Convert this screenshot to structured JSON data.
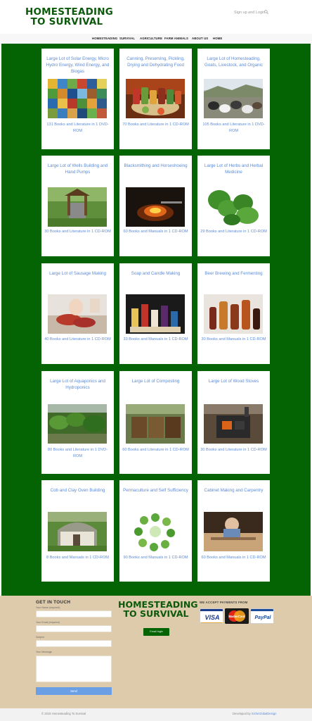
{
  "brand": {
    "logo_line1": "HOMESTEADING",
    "logo_line2": "TO SURVIVAL"
  },
  "header": {
    "signin": "Sign up and Login"
  },
  "nav": {
    "items": [
      "HOMESTEADING",
      "SURVIVAL",
      "AGRICULTURE",
      "FARM ANIMALS",
      "ABOUT US",
      "HOME"
    ]
  },
  "products": [
    {
      "title": "Large Lot of Solar Energy, Micro Hydro Energy, Wind Energy, and Biogas",
      "desc": "131 Books and Literature in 1 DVD-ROM"
    },
    {
      "title": "Canning, Preserving, Pickling, Drying and Dehydrating Food",
      "desc": "70 Books and Literature in 1 CD-ROM"
    },
    {
      "title": "Large Lot of Homesteading, Goats, Livestock, and Organic",
      "desc": "105 Books and Literature in 1 DVD-ROM"
    },
    {
      "title": "Large Lot of Wells Building and Hand Pumps",
      "desc": "30 Books and Literature in 1 CD-ROM"
    },
    {
      "title": "Blacksmithing and Horseshoeing",
      "desc": "60 Books and Manuals in 1 CD-ROM"
    },
    {
      "title": "Large Lot of Herbs and Herbal Medicine",
      "desc": "29 Books and Literature in 1 CD-ROM"
    },
    {
      "title": "Large Lot of Sausage Making",
      "desc": "40 Books and Literature in 1 CD-ROM"
    },
    {
      "title": "Soap and Candle Making",
      "desc": "33 Books and Manuals in 1 CD-ROM"
    },
    {
      "title": "Beer Brewing and Fermenting",
      "desc": "30 Books and Manuals in 1 CD-ROM"
    },
    {
      "title": "Large Lot of Aquaponics and Hydroponics",
      "desc": "80 Books and Literature in 1 DVD-ROM"
    },
    {
      "title": "Large Lot of Composting",
      "desc": "60 Books and Literature in 1 CD-ROM"
    },
    {
      "title": "Large Lot of Wood Stoves",
      "desc": "30 Books and Literature in 1 CD-ROM"
    },
    {
      "title": "Cob and Clay Oven Building",
      "desc": "8 Books and Manuals in 1 CD-ROM"
    },
    {
      "title": "Permaculture and Self Sufficiency",
      "desc": "90 Books and Manuals in 1 CD-ROM"
    },
    {
      "title": "Cabinet Making and Carpentry",
      "desc": "60 Books and Manuals in 1 CD-ROM"
    }
  ],
  "footer": {
    "contact_title": "GET IN TOUCH",
    "name_label": "Your Name (required)",
    "email_label": "Your Email (required)",
    "subject_label": "Subject",
    "message_label": "Your Message",
    "send_label": "Send",
    "email_button": "Email login",
    "payments_title": "WE ACCEPT PAYMENTS FROM",
    "payments": [
      "VISA",
      "MasterCard",
      "PayPal"
    ],
    "copyright": "© 2016 Homesteading To Survival",
    "developed_prefix": "Developed by",
    "developed_link": "XicheGlobalDesign"
  },
  "colors": {
    "brand_green": "#046404",
    "link_blue": "#5d8bd8",
    "footer_bg": "#decbab"
  },
  "icons": {
    "search": "search-icon"
  }
}
